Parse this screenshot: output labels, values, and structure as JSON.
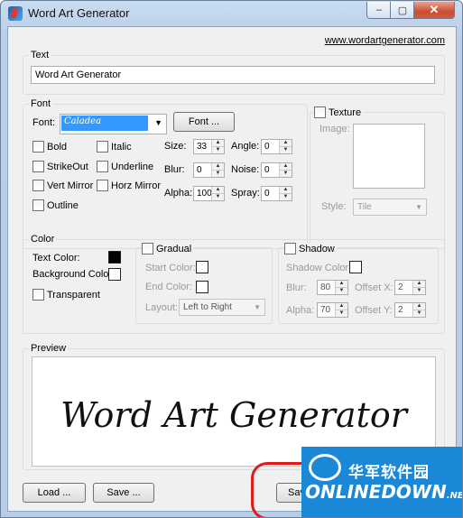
{
  "window": {
    "title": "Word Art Generator",
    "minimize_glyph": "–",
    "maximize_glyph": "▢",
    "close_glyph": "✕"
  },
  "header": {
    "website_link": "www.wordartgenerator.com"
  },
  "text_group": {
    "label": "Text",
    "value": "Word Art Generator"
  },
  "font_group": {
    "label": "Font",
    "font_label": "Font:",
    "font_value": "Caladea",
    "font_button": "Font ...",
    "checkboxes": {
      "bold": "Bold",
      "italic": "Italic",
      "strikeout": "StrikeOut",
      "underline": "Underline",
      "vert_mirror": "Vert Mirror",
      "horz_mirror": "Horz Mirror",
      "outline": "Outline"
    },
    "spinners": {
      "size": {
        "label": "Size:",
        "value": "33"
      },
      "angle": {
        "label": "Angle:",
        "value": "0"
      },
      "blur": {
        "label": "Blur:",
        "value": "0"
      },
      "noise": {
        "label": "Noise:",
        "value": "0"
      },
      "alpha": {
        "label": "Alpha:",
        "value": "100"
      },
      "spray": {
        "label": "Spray:",
        "value": "0"
      }
    }
  },
  "texture_group": {
    "label": "Texture",
    "image_label": "Image:",
    "style_label": "Style:",
    "style_value": "Tile"
  },
  "color_group": {
    "label": "Color",
    "text_color_label": "Text Color:",
    "text_color": "#000000",
    "background_color_label": "Background Color",
    "background_color": "#ffffff",
    "transparent_label": "Transparent"
  },
  "gradual_group": {
    "label": "Gradual",
    "start_color_label": "Start Color:",
    "end_color_label": "End Color:",
    "layout_label": "Layout:",
    "layout_value": "Left to Right"
  },
  "shadow_group": {
    "label": "Shadow",
    "shadow_color_label": "Shadow Color:",
    "blur": {
      "label": "Blur:",
      "value": "80"
    },
    "alpha": {
      "label": "Alpha:",
      "value": "70"
    },
    "offset_x": {
      "label": "Offset X:",
      "value": "2"
    },
    "offset_y": {
      "label": "Offset Y:",
      "value": "2"
    }
  },
  "preview_group": {
    "label": "Preview",
    "text": "Word Art Generator"
  },
  "footer": {
    "load_button": "Load ...",
    "save_button": "Save ...",
    "save_as_button": "Sav"
  },
  "watermark": {
    "chinese": "华军软件园",
    "brand": "ONLINEDOWN",
    "suffix": ".NET"
  },
  "colors": {
    "title_gradient": "#b9cfe9",
    "close_button": "#c84d32",
    "watermark_bg": "#1a88d6",
    "highlight_ring": "#e01b1b",
    "font_select_bg": "#3399ff"
  }
}
